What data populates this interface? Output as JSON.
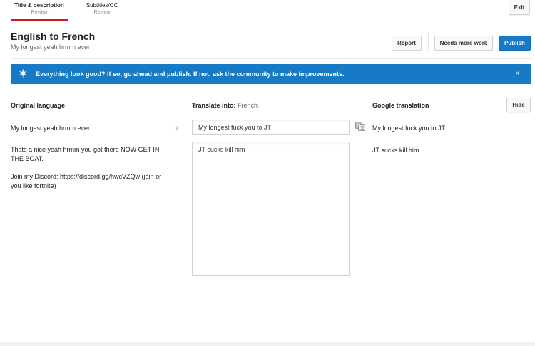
{
  "tabs": [
    {
      "label": "Title & description",
      "sublabel": "Review"
    },
    {
      "label": "Subtitles/CC",
      "sublabel": "Review"
    }
  ],
  "exit_label": "Exit",
  "header": {
    "title": "English to French",
    "subtitle": "My longest yeah hrmm ever",
    "report_label": "Report",
    "needs_work_label": "Needs more work",
    "publish_label": "Publish"
  },
  "banner": {
    "text": "Everything look good? If so, go ahead and publish. If not, ask the community to make improvements.",
    "close": "×"
  },
  "columns": {
    "original_heading": "Original language",
    "translate_heading": "Translate into:",
    "translate_language": "French",
    "google_heading": "Google translation",
    "hide_label": "Hide"
  },
  "original": {
    "title": "My longest yeah hrmm ever",
    "description_line1": "Thats a nice yeah hrmm you got there NOW GET IN THE BOAT.",
    "description_line2": "Join my Discord: https://discord.gg/hwcVZQw (join or you like fortnite)"
  },
  "translation": {
    "title_value": "My longest fuck you to JT",
    "description_value": "JT sucks kill him"
  },
  "google": {
    "title": "My longest fuck you to JT",
    "description": "JT sucks kill him"
  },
  "colors": {
    "accent": "#167ac6",
    "active_tab": "#cc181e"
  }
}
